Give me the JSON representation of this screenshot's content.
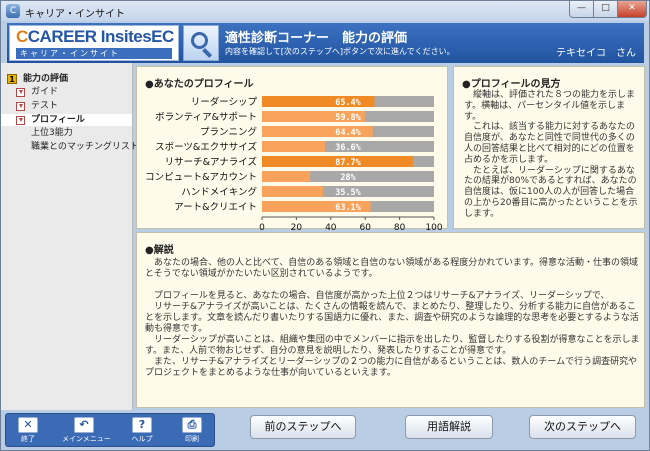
{
  "window": {
    "title": "キャリア・インサイト"
  },
  "header": {
    "logo_text": "CAREER Insites",
    "logo_suffix": "EC",
    "logo_sub": "キャリア・インサイト",
    "title": "適性診断コーナー　能力の評価",
    "subtitle": "内容を確認して[次のステップへ]ボタンで次に進んでください。",
    "user": "テキセイコ　さん"
  },
  "sidebar": {
    "items": [
      {
        "label": "能力の評価",
        "marker": "1"
      },
      {
        "label": "ガイド"
      },
      {
        "label": "テスト"
      },
      {
        "label": "プロフィール"
      },
      {
        "label": "上位3能力"
      },
      {
        "label": "職業とのマッチングリスト"
      }
    ]
  },
  "profile": {
    "heading": "●あなたのプロフィール"
  },
  "chart_data": {
    "type": "bar",
    "orientation": "horizontal",
    "categories": [
      "リーダーシップ",
      "ボランティア&サポート",
      "プランニング",
      "スポーツ&エクササイズ",
      "リサーチ&アナライズ",
      "コンピュート&アカウント",
      "ハンドメイキング",
      "アート&クリエイト"
    ],
    "values": [
      65.4,
      59.8,
      64.4,
      36.6,
      87.7,
      28,
      35.5,
      63.1
    ],
    "value_labels": [
      "65.4%",
      "59.8%",
      "64.4%",
      "36.6%",
      "87.7%",
      "28%",
      "35.5%",
      "63.1%"
    ],
    "highlight": [
      true,
      false,
      false,
      false,
      true,
      false,
      false,
      false
    ],
    "xlim": [
      0,
      100
    ],
    "xticks": [
      "0",
      "20",
      "40",
      "60",
      "80",
      "100"
    ],
    "colors": {
      "bar": "#f7a35c",
      "bar_highlight": "#f08a24",
      "track": "#a8a8a8",
      "label": "#ffffff"
    }
  },
  "view": {
    "heading": "●プロフィールの見方",
    "text": "　縦軸は、評価された８つの能力を示します。横軸は、パーセンタイル値を示します。\n　これは、該当する能力に対するあなたの自信度が、あなたと同性で同世代の多くの人の回答結果と比べて相対的にどの位置を占めるかを示します。\n　たとえば、リーダーシップに関するあなたの結果が80%であるとすれば、あなたの自信度は、仮に100人の人が回答した場合の上から20番目に高かったということを示します。"
  },
  "explanation": {
    "heading": "●解説",
    "paragraphs": [
      "　あなたの場合、他の人と比べて、自信のある領域と自信のない領域がある程度分かれています。得意な活動・仕事の領域とそうでない領域がかたいたい区別されているようです。",
      "　プロフィールを見ると、あなたの場合、自信度が高かった上位２つはリサーチ&アナライズ、リーダーシップで、\n　リサーチ&アナライズが高いことは、たくさんの情報を読んで、まとめたり、整理したり、分析する能力に自信があることを示します。文章を読んだり書いたりする国語力に優れ、また、調査や研究のような論理的な思考を必要とするような活動も得意です。\n　リーダーシップが高いことは、組織や集団の中でメンバーに指示を出したり、監督したりする役割が得意なことを示します。また、人前で物おじせず、自分の意見を説明したり、発表したりすることが得意です。\n　また、リサーチ&アナライズとリーダーシップの２つの能力に自信があるということは、数人のチームで行う調査研究やプロジェクトをまとめるような仕事が向いているといえます。"
    ]
  },
  "toolbar": {
    "exit": "終了",
    "main_menu": "メインメニュー",
    "help": "ヘルプ",
    "print": "印刷"
  },
  "buttons": {
    "prev": "前のステップへ",
    "glossary": "用語解説",
    "next": "次のステップへ"
  }
}
